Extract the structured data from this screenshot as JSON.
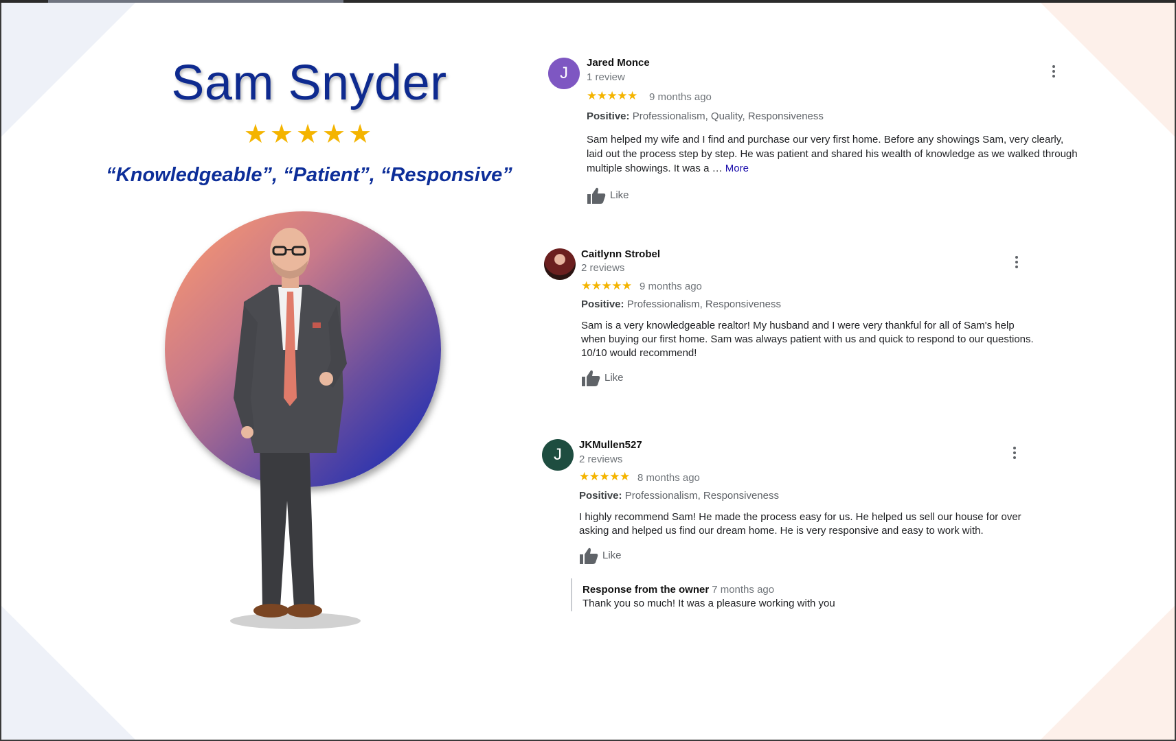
{
  "hero": {
    "name": "Sam Snyder",
    "stars": "★★★★★",
    "quote": "“Knowledgeable”, “Patient”, “Responsive”"
  },
  "colors": {
    "name_blue": "#0e2a8f",
    "star_gold": "#f4b400",
    "avatar_purple": "#7e57c2",
    "avatar_green": "#1e4d40"
  },
  "reviews": [
    {
      "avatar_letter": "J",
      "name": "Jared Monce",
      "count": "1 review",
      "stars": "★★★★★",
      "time": "9 months ago",
      "positive_label": "Positive:",
      "positive": "Professionalism, Quality, Responsiveness",
      "text": "Sam helped my wife and I find and purchase our very first home. Before any showings Sam, very clearly, laid out the process step by step. He was patient and shared his wealth of knowledge as we walked through multiple showings. It was a …",
      "more": "More",
      "like": "Like"
    },
    {
      "avatar_letter": "",
      "name": "Caitlynn Strobel",
      "count": "2 reviews",
      "stars": "★★★★★",
      "time": "9 months ago",
      "positive_label": "Positive:",
      "positive": "Professionalism, Responsiveness",
      "text": "Sam is a very knowledgeable realtor! My husband and I were very thankful for all of Sam's help when buying our first home. Sam was always patient with us and quick to respond to our questions. 10/10 would recommend!",
      "like": "Like"
    },
    {
      "avatar_letter": "J",
      "name": "JKMullen527",
      "count": "2 reviews",
      "stars": "★★★★★",
      "time": "8 months ago",
      "positive_label": "Positive:",
      "positive": "Professionalism, Responsiveness",
      "text": "I highly recommend Sam! He made the process easy for us. He helped us sell our house for over asking and helped us find our dream home. He is very responsive and easy to work with.",
      "like": "Like",
      "owner_response": {
        "title": "Response from the owner",
        "time": "7 months ago",
        "text": "Thank you so much! It was a pleasure working with you"
      }
    }
  ]
}
